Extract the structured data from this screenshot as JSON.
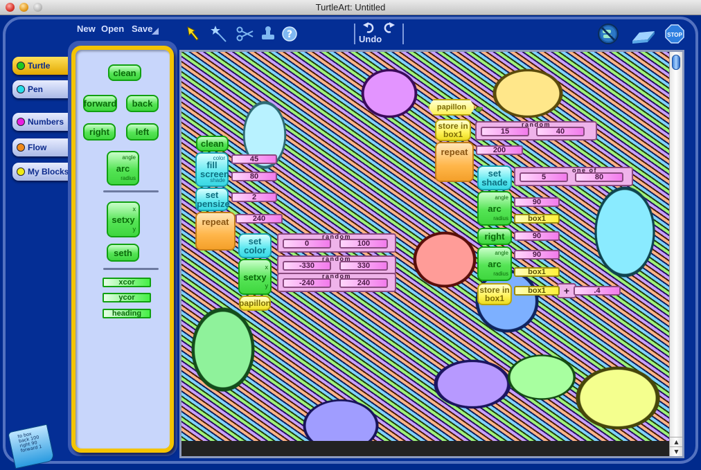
{
  "window": {
    "title": "TurtleArt: Untitled"
  },
  "toolbar": {
    "new_label": "New",
    "open_label": "Open",
    "save_label": "Save",
    "undo_label": "Undo",
    "tools": [
      "arrow-pointer-icon",
      "magic-wand-icon",
      "scissors-icon",
      "stamp-icon",
      "help-icon"
    ],
    "right_tools": [
      "hide-blocks-icon",
      "eraser-icon",
      "stop-icon"
    ],
    "stop_label": "STOP"
  },
  "categories": [
    {
      "label": "Turtle",
      "color": "#1fc81f",
      "active": true
    },
    {
      "label": "Pen",
      "color": "#26dde8",
      "active": false
    },
    {
      "label": "Numbers",
      "color": "#e81fe0",
      "active": false
    },
    {
      "label": "Flow",
      "color": "#f08a1a",
      "active": false
    },
    {
      "label": "My Blocks",
      "color": "#f0ea14",
      "active": false
    }
  ],
  "palette": {
    "clean": "clean",
    "forward": "forward",
    "back": "back",
    "right": "right",
    "left": "left",
    "arc": "arc",
    "arc_angle": "angle",
    "arc_radius": "radius",
    "setxy": "setxy",
    "setxy_x": "x",
    "setxy_y": "y",
    "seth": "seth",
    "xcor": "xcor",
    "ycor": "ycor",
    "heading": "heading"
  },
  "script_left": {
    "clean": "clean",
    "fill_screen": "fill screen",
    "fill_color_label": "color",
    "fill_color_value": "45",
    "fill_shade_label": "shade",
    "fill_shade_value": "80",
    "set_pensize": "set pensize",
    "pensize_value": "2",
    "repeat": "repeat",
    "repeat_value": "240",
    "set_color": "set color",
    "random_label": "random",
    "color_min": "0",
    "color_max": "100",
    "setxy": "setxy",
    "x_label": "x",
    "y_label": "y",
    "x_min": "-330",
    "x_max": "330",
    "y_min": "-240",
    "y_max": "240",
    "papillon": "papillon"
  },
  "script_right": {
    "hat": "papillon",
    "store_in": "store in box1",
    "random_label": "random",
    "rand_min": "15",
    "rand_max": "40",
    "repeat": "repeat",
    "repeat_value": "200",
    "set_shade": "set shade",
    "one_of_label": "one of",
    "shade_a": "5",
    "shade_b": "80",
    "arc": "arc",
    "angle_label": "angle",
    "radius_label": "radius",
    "arc1_angle": "90",
    "arc1_radius": "box1",
    "right": "right",
    "right_value": "90",
    "arc2_angle": "90",
    "arc2_radius": "box1",
    "store_in2": "store in box1",
    "plus": "+",
    "add_box": "box1",
    "add_value": ".4"
  },
  "script_icon_text": "to box\nback 100\nright 90\nforward 1"
}
